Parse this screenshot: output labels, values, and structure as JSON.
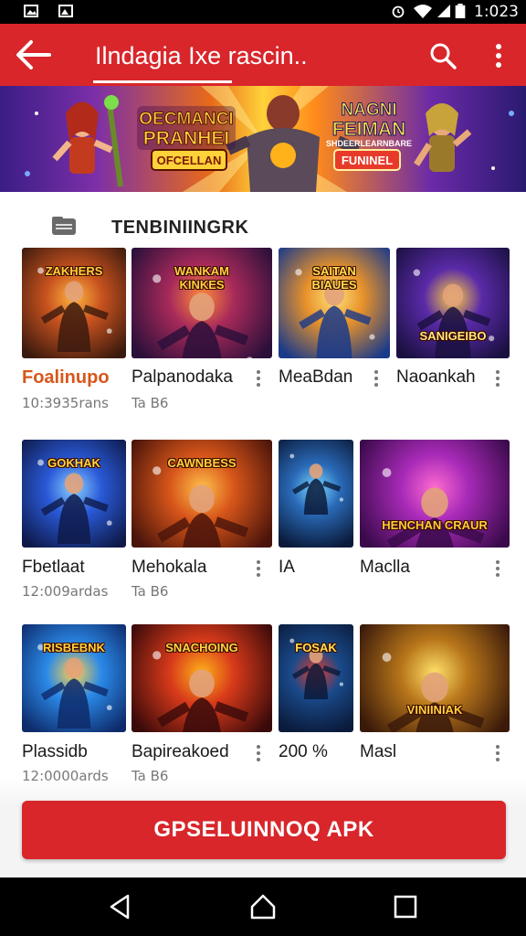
{
  "status_bar": {
    "time": "1:023",
    "icons": [
      "image-icon",
      "gallery-icon",
      "alarm-icon",
      "wifi-icon",
      "signal-icon",
      "battery-icon"
    ]
  },
  "app_bar": {
    "title": "Ilndagia Ixe rascin..",
    "icons": [
      "back-arrow-icon",
      "search-icon",
      "more-vert-icon"
    ]
  },
  "banner": {
    "logo_left": "OECMANCI\nPRANHEI",
    "pill_left": "OFCELLAN",
    "logo_right": "NAGNI\nFEIMAN",
    "logo_right_sub": "SHDEERLEARNBARE",
    "pill_right": "FUNINEL"
  },
  "section": {
    "icon": "folder-icon",
    "title": "TENBINIINGRK"
  },
  "games": [
    {
      "name": "Foalinupo",
      "meta": "10:3935rans",
      "art": "ZAKHERS"
    },
    {
      "name": "Palpanodaka",
      "meta": "Ta  B6",
      "art": "WANKAM\nKINKES"
    },
    {
      "name": "MeaBdan",
      "meta": "",
      "art": "SAITAN\nBIAUES"
    },
    {
      "name": "Naoankah",
      "meta": "",
      "art": "SANIGEIBO"
    },
    {
      "name": "Fbetlaat",
      "meta": "12:009ardas",
      "art": "GOKHAK"
    },
    {
      "name": "Mehokala",
      "meta": "Ta  B6",
      "art": "CAWNBESS"
    },
    {
      "name": "IA",
      "meta": "",
      "art": ""
    },
    {
      "name": "Maclla",
      "meta": "",
      "art": "HENCHAN CRAUR"
    },
    {
      "name": "Plassidb",
      "meta": "12:0000ards",
      "art": "RISBEBNK"
    },
    {
      "name": "Bapireakoed",
      "meta": "Ta  B6",
      "art": "SNACHOING"
    },
    {
      "name": "200 %",
      "meta": "",
      "art": "FOSAK"
    },
    {
      "name": "Masl",
      "meta": "",
      "art": "VINIINIAK"
    }
  ],
  "cta": {
    "label": "GPSELUINNOQ APK"
  },
  "nav_bar": {
    "icons": [
      "back-triangle-icon",
      "home-icon",
      "recents-square-icon"
    ]
  },
  "colors": {
    "accent": "#d8262b",
    "status_bar": "#000000",
    "nav_bar": "#000000",
    "meta_text": "#777777"
  }
}
